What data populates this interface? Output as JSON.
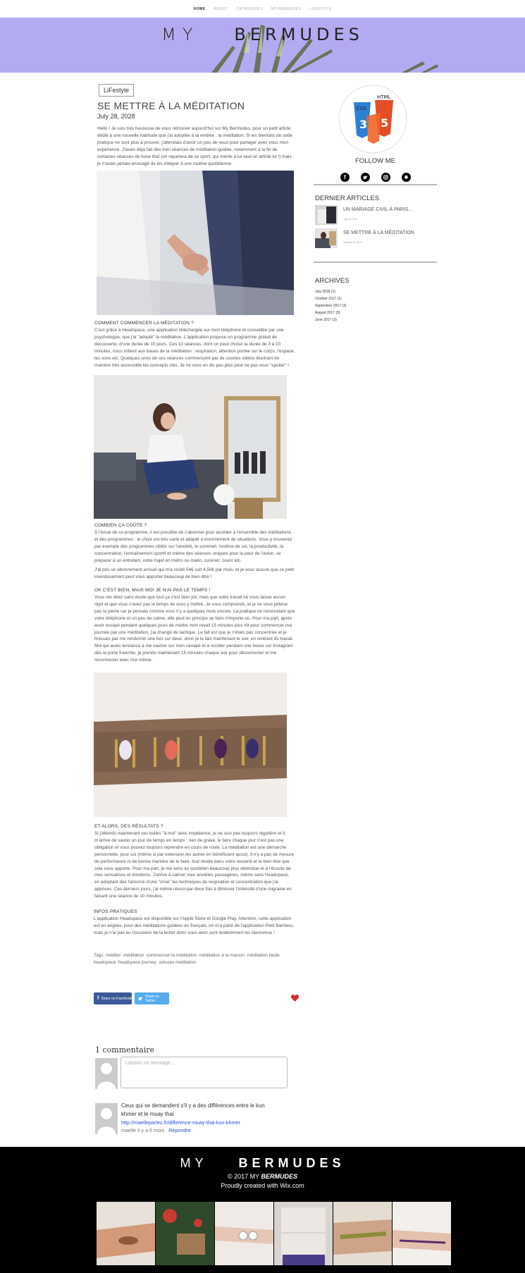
{
  "nav": {
    "items": [
      "HOME",
      "ABOUT",
      "CATEGORIES",
      "MY BERMUDES",
      "LIFESTYLE"
    ]
  },
  "banner": {
    "title_left": "MY",
    "title_right": "BERMUDES"
  },
  "post": {
    "category": "LiFestyle",
    "title": "SE METTRE À LA MÉDITATION",
    "date": "July 28, 2028",
    "intro": "Hello ! Je suis très heureuse de vous retrouver aujourd'hui sur My Bermudes, pour un petit article dédié à une nouvelle habitude que j'ai adoptée à la rentrée : la méditation. Si les bienfaits de cette pratique ne sont plus à prouver, j'attendais d'avoir un peu de recul pour partager avec vous mon expérience. J'avais déjà fait des mini séances de méditation guidée, notamment à la fin de certaines séances de boxe thaï (on reparlera de ce sport, qui mérite à lui seul un article lol !) mais je n'avais jamais envisagé de les intégrer à une routine quotidienne.",
    "s1_title": "COMMENT COMMENCER LA MÉDITATION ?",
    "s1_text": "C'est grâce à Headspace, une application téléchargée sur mon téléphone et conseillée par une psychologue, que j'ai \"adopté\" la méditation. L'application propose un programme gratuit de découverte, d'une durée de 10 jours. Ces 10 séances, dont on peut choisir la durée de 3 à 10 minutes, nous initient aux bases de la méditation : respiration, attention portée sur le corps, l'espace, les sons etc. Quelques unes de ces séances commencent par de courtes vidéos illustrant de manière très accessible les concepts clés. Je ne vous en dis pas plus pour ne pas vous \"spoiler\" !",
    "s2_title": "COMBIEN ÇA COÛTE ?",
    "s2_text": "À l'issue de ce programme, il est possible de s'abonner pour accéder à l'ensemble des méditations et des programmes : le choix est très varié et adapté à énormément de situations. Vous y trouverez par exemple des programmes ciblés sur l'anxiété, le sommeil, l'estime de soi, la productivité, la concentration, l'entraînement sportif et même des séances uniques pour la peur de l'avion, se préparer à un entretien, votre trajet en métro ou matin, cuisiner, courir etc.",
    "s2_text_b": "J'ai pris un abonnement annuel qui m'a coûté 54€ soit 4,50€ par mois, et je vous assure que ce petit investissement peut vous apporter beaucoup de bien être !",
    "s3_title": "OK C'EST BIEN, MAIS MOI JE N'AI PAS LE TEMPS !",
    "s3_text": "Vous me direz sans doute que tout ça c'est bien joli, mais que votre travail ne vous laisse aucun répit et que vous n'avez pas le temps de vous y mettre. Je vous comprends, et je ne vous jetterai pas la pierre car je pensais comme vous il y a quelques mois encore. La pratique ne nécessitant que votre téléphone et un peu de calme, elle peut en principe se faire n'importe où. Pour ma part, après avoir essayé pendant quelques jours de mettre mon réveil 15 minutes plus tôt pour commencer ma journée par une méditation, j'ai changé de tactique. Le fait est que je n'étais pas concentrée et je finissais par me rendormir une fois sur deux, donc je le fais maintenant le soir, en rentrant du travail. Moi qui avais tendance à me vautrer sur mon canapé et à scroller pendant une heure sur Instagram dès la porte franchie, je prends maintenant 15 minutes chaque soir pour déconnecter et me reconnecter avec moi même.",
    "s4_title": "ET ALORS, DES RÉSULTATS ?",
    "s4_text": "Si j'attends maintenant ces bulles \"à moi\" avec impatience, je ne suis pas toujours régulière et il m'arrive de sauter un jour de temps en temps : rien de grave, le faire chaque jour n'est pas une obligation et vous pouvez toujours reprendre en cours de route. La méditation est une démarche personnelle, pour soi (même si par extension les autres en bénéficient aussi). Il n'y a pas de mesure de performance ni de bonne manière de le faire, tout réside dans votre ressenti et le bien être que cela vous apporte. Pour ma part, je me sens au quotidien beaucoup plus détendue et à l'écoute de mes sensations et émotions. J'arrive à calmer mes anxiétés passagères, même sans Headspace, en adoptant des l'amorce d'une \"crise\" les techniques de respiration et concentration que j'ai apprises. Ces derniers jours, j'ai même réussi par deux fois à diminuer l'intensité d'une migraine en faisant une séance de 10 minutes.",
    "s5_title": "INFOS PRATIQUES",
    "s5_text": "L'application Headspace est disponible sur l'Apple Store et Google Play. Attention, cette application est en anglais, pour des méditations guidées en français, on m'a parlé de l'application Petit Bambou, mais je n'ai pas eu l'occasion de la tester donc vous avez sont évidemment les bienvenus !",
    "tags_label": "Tags:",
    "tags": [
      "méditer",
      "méditation",
      "commencer la méditation",
      "méditation à la maison",
      "méditation facile headspace",
      "headspace journey",
      "astuces méditation"
    ]
  },
  "share": {
    "facebook": "Share on Facebook",
    "twitter": "Share on Twitter"
  },
  "comments": {
    "title": "1 commentaire",
    "placeholder": "Laissez un message...",
    "comment_text": "Ceux qui se demandent s'il y a des différences entre le kun khmer et le muay thaï",
    "comment_link": "http://maelleparlez.fr/difference-muay-thai-kun-khmer",
    "comment_author": "maelle il y a 6 mois",
    "reply": "Répondre"
  },
  "sidebar": {
    "follow": "FOLLOW ME",
    "latest_title": "DERNIER ARTICLES",
    "latest": [
      {
        "title": "UN MARIAGE CIVIL À PARIS...",
        "date": "July 28, 2017"
      },
      {
        "title": "SE METTRE À LA MÉDITATION",
        "date": "October 12, 2017"
      }
    ],
    "archives_title": "ARCHIVES",
    "archives": [
      "July 2018 (1)",
      "October 2017 (1)",
      "September 2017 (3)",
      "August 2017 (3)",
      "June 2017 (3)"
    ]
  },
  "footer": {
    "title_left": "MY",
    "title_right": "BERMUDES",
    "copyright": "© 2017 MY",
    "copyright_brand": "BERMUDES",
    "credit": "Proudly created with Wix.com"
  },
  "colors": {
    "banner": "#b3abf1",
    "facebook": "#3b5998",
    "twitter": "#55acee",
    "heart": "#d32f2f"
  }
}
